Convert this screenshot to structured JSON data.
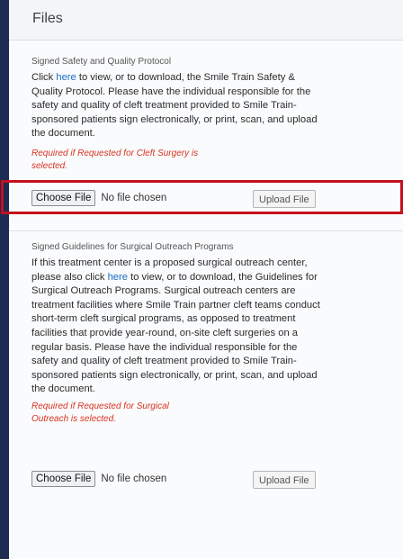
{
  "header": {
    "title": "Files"
  },
  "section1": {
    "label": "Signed Safety and Quality Protocol",
    "desc_before": "Click ",
    "link": "here",
    "desc_after": " to view, or to download, the Smile Train Safety & Quality Protocol. Please have the individual responsible for the safety and quality of cleft treatment provided to Smile Train-sponsored patients sign electronically, or print, scan, and upload the document.",
    "required": "Required if Requested for Cleft Surgery is selected.",
    "choose_label": "Choose File",
    "no_file": "No file chosen",
    "upload_label": "Upload File"
  },
  "section2": {
    "label": "Signed Guidelines for Surgical Outreach Programs",
    "desc_before": "If this treatment center is a proposed surgical outreach center, please also click ",
    "link": "here",
    "desc_after": " to view, or to download, the Guidelines for Surgical Outreach Programs. Surgical outreach centers are treatment facilities where Smile Train partner cleft teams conduct short-term cleft surgical programs, as opposed to treatment facilities that provide year-round, on-site cleft surgeries on a regular basis. Please have the individual responsible for the safety and quality of cleft treatment provided to Smile Train-sponsored patients sign electronically, or print, scan, and upload the document.",
    "required": "Required if Requested for Surgical Outreach is selected.",
    "choose_label": "Choose File",
    "no_file": "No file chosen",
    "upload_label": "Upload File"
  },
  "colors": {
    "highlight": "#c4101f",
    "link": "#1b6ec2",
    "required": "#d8321e"
  }
}
